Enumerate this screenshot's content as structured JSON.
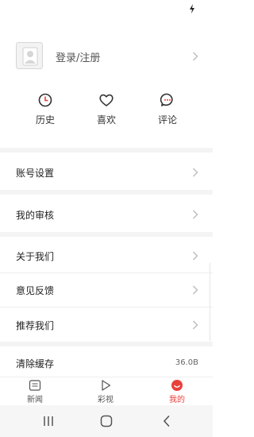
{
  "colors": {
    "accent": "#e8403b",
    "icon_dark": "#333333",
    "chevron": "#b8b8b8"
  },
  "profile": {
    "login_label": "登录/注册",
    "avatar_icon": "default-avatar-icon"
  },
  "quick_actions": [
    {
      "label": "历史",
      "icon": "clock-icon"
    },
    {
      "label": "喜欢",
      "icon": "heart-icon"
    },
    {
      "label": "评论",
      "icon": "comment-icon"
    }
  ],
  "menu": {
    "account_settings": "账号设置",
    "my_review": "我的审核",
    "about_us": "关于我们",
    "feedback": "意见反馈",
    "recommend": "推荐我们",
    "clear_cache": "清除缓存",
    "cache_size": "36.0B"
  },
  "tabs": {
    "news": "新闻",
    "video": "彩视",
    "mine": "我的",
    "active": "mine"
  }
}
